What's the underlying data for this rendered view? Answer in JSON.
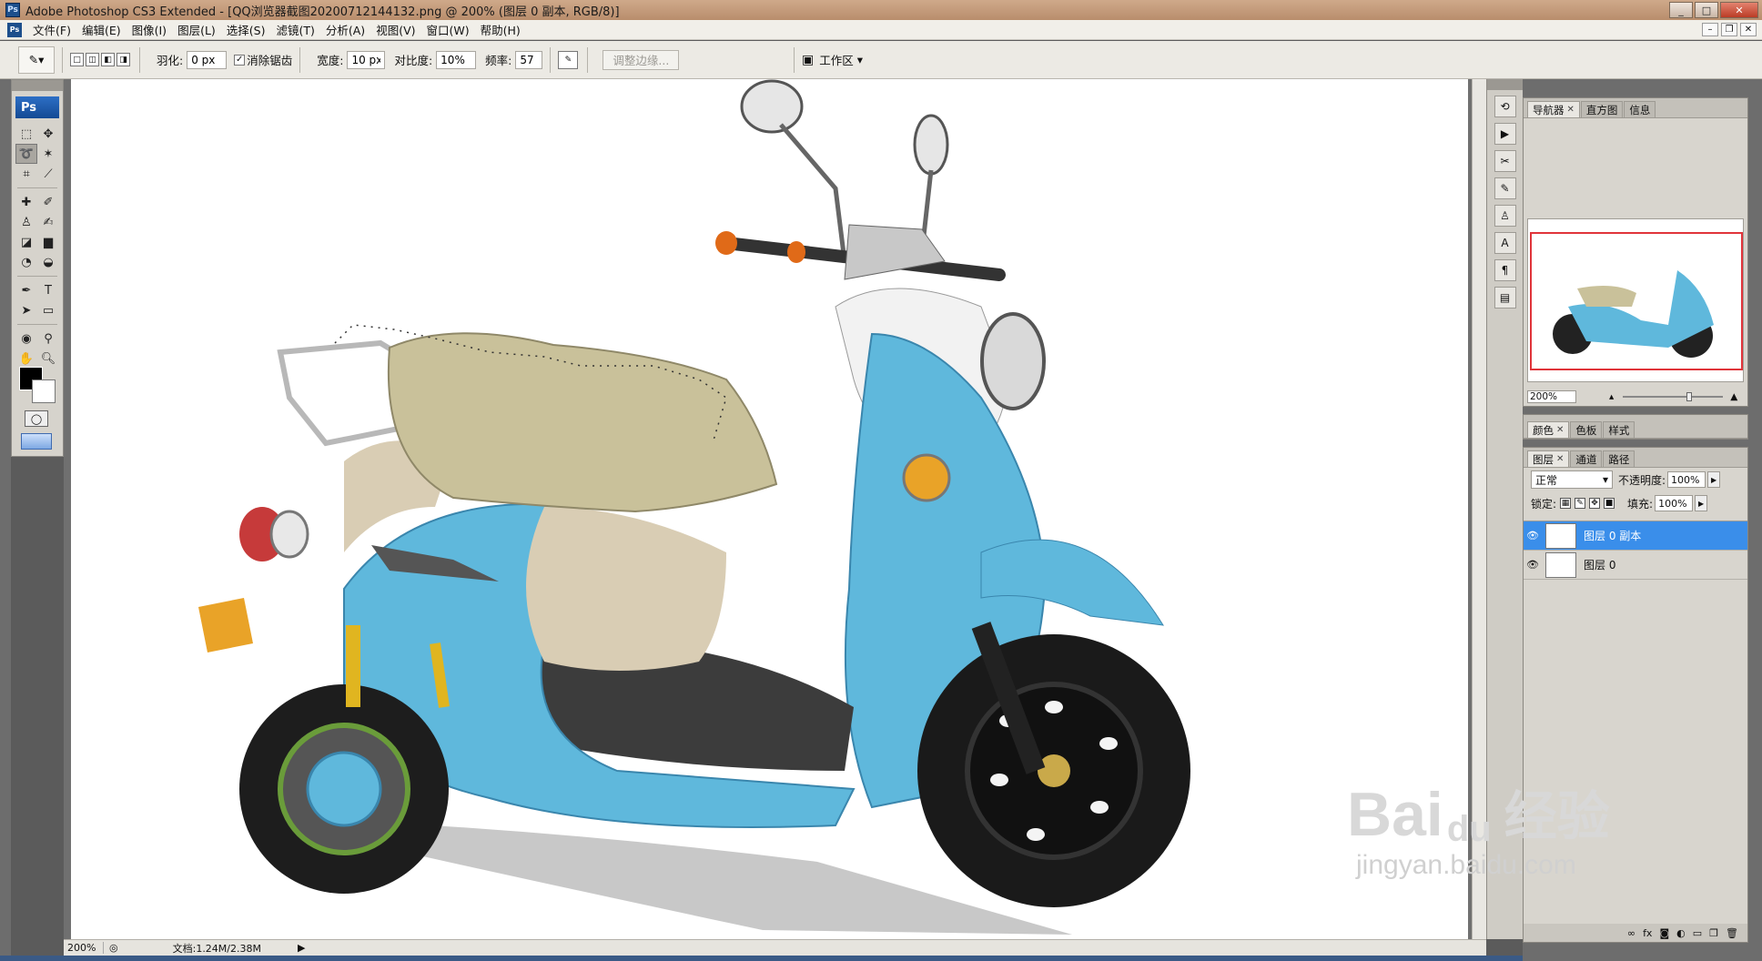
{
  "titlebar": {
    "logo": "Ps",
    "title": "Adobe Photoshop CS3 Extended - [QQ浏览器截图20200712144132.png @ 200% (图层 0 副本, RGB/8)]",
    "buttons": [
      "_",
      "□",
      "✕"
    ]
  },
  "menubar": {
    "items": [
      "文件(F)",
      "编辑(E)",
      "图像(I)",
      "图层(L)",
      "选择(S)",
      "滤镜(T)",
      "分析(A)",
      "视图(V)",
      "窗口(W)",
      "帮助(H)"
    ]
  },
  "options": {
    "feather_label": "羽化:",
    "feather_value": "0 px",
    "antialias_label": "消除锯齿",
    "width_label": "宽度:",
    "width_value": "10 px",
    "contrast_label": "对比度:",
    "contrast_value": "10%",
    "frequency_label": "频率:",
    "frequency_value": "57",
    "refine_edge": "调整边缘...",
    "workspace": "工作区"
  },
  "toolpanel": {
    "logo": "Ps"
  },
  "status": {
    "zoom": "200%",
    "doc": "文档:1.24M/2.38M"
  },
  "navigator": {
    "tabs": [
      "导航器",
      "直方图",
      "信息"
    ],
    "zoom": "200%"
  },
  "color_panel": {
    "tabs": [
      "颜色",
      "色板",
      "样式"
    ]
  },
  "layers_panel": {
    "tabs": [
      "图层",
      "通道",
      "路径"
    ],
    "blend_mode": "正常",
    "opacity_label": "不透明度:",
    "opacity_value": "100%",
    "lock_label": "锁定:",
    "fill_label": "填充:",
    "fill_value": "100%",
    "layers": [
      {
        "name": "图层 0 副本",
        "selected": true
      },
      {
        "name": "图层 0",
        "selected": false
      }
    ]
  },
  "watermark": {
    "brand": "Bai",
    "paw": "du",
    "cn": "经验",
    "url": "jingyan.baidu.com"
  },
  "colors": {
    "scooter_blue": "#5fb8dc",
    "seat_beige": "#c9c19a",
    "selection_red": "#e0343a",
    "layer_selected": "#3a8eea"
  }
}
